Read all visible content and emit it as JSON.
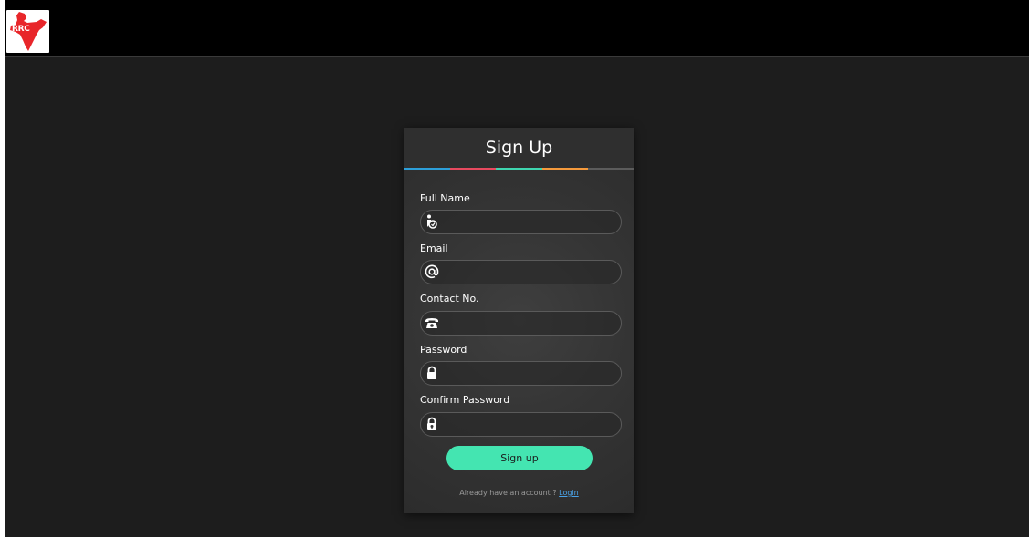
{
  "brand": {
    "logo_text": "RRC",
    "logo_color": "#e8262a"
  },
  "form": {
    "title": "Sign Up",
    "stripe_colors": [
      "#2d9fd9",
      "#e84a5f",
      "#3fd6b0",
      "#f59a3c",
      "#5c5c5c"
    ],
    "fields": [
      {
        "label": "Full Name",
        "icon": "person-icon",
        "value": "",
        "type": "text"
      },
      {
        "label": "Email",
        "icon": "at-icon",
        "value": "",
        "type": "email"
      },
      {
        "label": "Contact No.",
        "icon": "phone-icon",
        "value": "",
        "type": "tel"
      },
      {
        "label": "Password",
        "icon": "lock-icon",
        "value": "",
        "type": "password"
      },
      {
        "label": "Confirm Password",
        "icon": "lock-keyhole-icon",
        "value": "",
        "type": "password"
      }
    ],
    "submit_label": "Sign up",
    "submit_color": "#44e5b1",
    "footer_text": "Already have an account ?",
    "login_link": "Login"
  }
}
